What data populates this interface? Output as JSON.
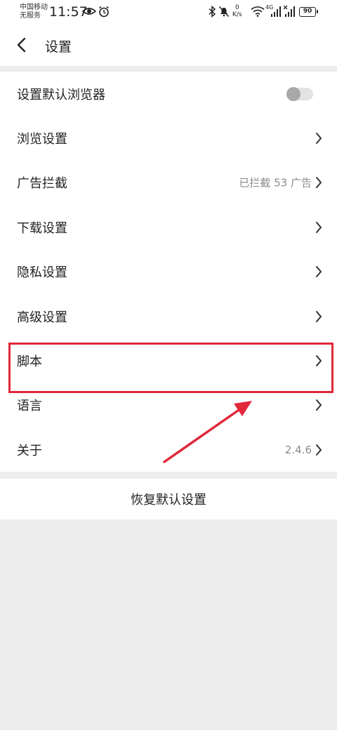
{
  "status_bar": {
    "carrier_line1": "中国移动",
    "carrier_line2": "无服务",
    "time": "11:57",
    "speed_value": "0",
    "speed_unit": "K/s",
    "network_type": "4G",
    "battery": "90"
  },
  "header": {
    "title": "设置"
  },
  "settings": {
    "items": [
      {
        "label": "设置默认浏览器",
        "control": "toggle",
        "toggle_on": false
      },
      {
        "label": "浏览设置",
        "control": "chevron"
      },
      {
        "label": "广告拦截",
        "value": "已拦截 53 广告",
        "control": "chevron"
      },
      {
        "label": "下载设置",
        "control": "chevron"
      },
      {
        "label": "隐私设置",
        "control": "chevron"
      },
      {
        "label": "高级设置",
        "control": "chevron"
      },
      {
        "label": "脚本",
        "control": "chevron",
        "highlighted": true
      },
      {
        "label": "语言",
        "control": "chevron"
      },
      {
        "label": "关于",
        "value": "2.4.6",
        "control": "chevron"
      }
    ]
  },
  "reset": {
    "label": "恢复默认设置"
  },
  "annotation": {
    "color": "#e0283a"
  }
}
